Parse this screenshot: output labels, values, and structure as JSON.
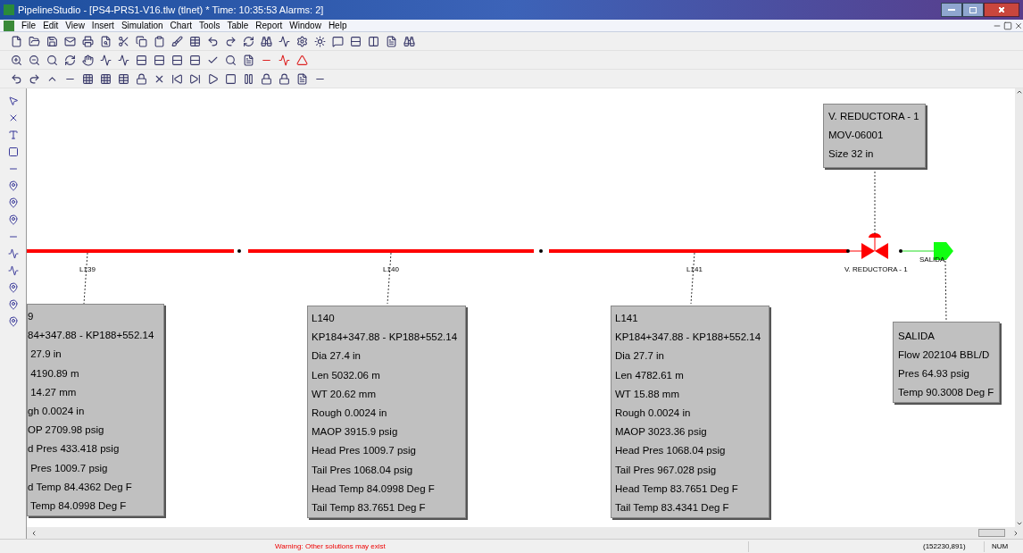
{
  "window": {
    "title": "PipelineStudio - [PS4-PRS1-V16.tlw (tlnet) * Time: 10:35:53 Alarms: 2]",
    "menu": [
      "File",
      "Edit",
      "View",
      "Insert",
      "Simulation",
      "Chart",
      "Tools",
      "Table",
      "Report",
      "Window",
      "Help"
    ]
  },
  "diagram": {
    "pipes": [
      {
        "label": "L139",
        "card": [
          "9",
          "84+347.88 - KP188+552.14",
          " 27.9 in",
          " 4190.89 m",
          " 14.27 mm",
          "gh 0.0024 in",
          "OP 2709.98 psig",
          "d Pres 433.418 psig",
          " Pres 1009.7 psig",
          "d Temp 84.4362 Deg F",
          " Temp 84.0998 Deg F"
        ]
      },
      {
        "label": "L140",
        "card": [
          "L140",
          "KP184+347.88 - KP188+552.14",
          "Dia 27.4 in",
          "Len 5032.06 m",
          "WT 20.62 mm",
          "Rough 0.0024 in",
          "MAOP 3915.9 psig",
          "Head Pres 1009.7 psig",
          "Tail Pres 1068.04 psig",
          "Head Temp 84.0998 Deg F",
          "Tail Temp 83.7651 Deg F"
        ]
      },
      {
        "label": "L141",
        "card": [
          "L141",
          "KP184+347.88 - KP188+552.14",
          "Dia 27.7 in",
          "Len 4782.61 m",
          "WT 15.88 mm",
          "Rough 0.0024 in",
          "MAOP 3023.36 psig",
          "Head Pres 1068.04 psig",
          "Tail Pres 967.028 psig",
          "Head Temp 83.7651 Deg F",
          "Tail Temp 83.4341 Deg F"
        ]
      }
    ],
    "valve": {
      "label": "V. REDUCTORA - 1",
      "card": [
        "V. REDUCTORA - 1",
        "MOV-06001",
        "Size 32 in"
      ]
    },
    "outlet": {
      "label": "SALIDA",
      "card": [
        "SALIDA",
        "Flow 202104 BBL/D",
        "Pres 64.93 psig",
        "Temp 90.3008 Deg F"
      ]
    }
  },
  "status_bar": {
    "message": "Warning: Other solutions may exist",
    "coordinates": "(152230,891)",
    "indicator": "NUM"
  }
}
